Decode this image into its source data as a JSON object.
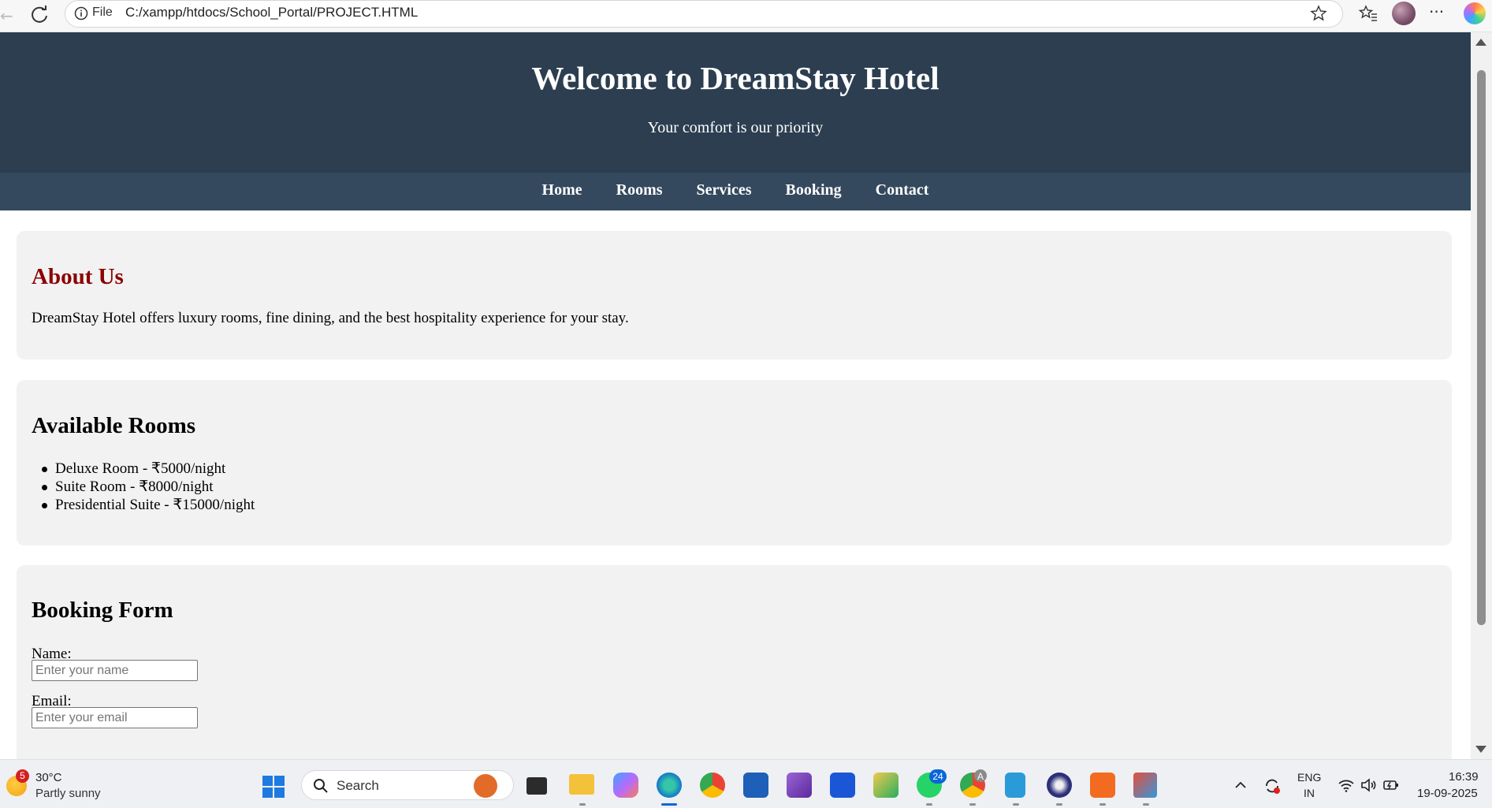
{
  "browser": {
    "file_label": "File",
    "url": "C:/xampp/htdocs/School_Portal/PROJECT.HTML"
  },
  "header": {
    "title": "Welcome to DreamStay Hotel",
    "tagline": "Your comfort is our priority"
  },
  "nav": {
    "items": [
      {
        "label": "Home"
      },
      {
        "label": "Rooms"
      },
      {
        "label": "Services"
      },
      {
        "label": "Booking"
      },
      {
        "label": "Contact"
      }
    ]
  },
  "about": {
    "heading": "About Us",
    "text": "DreamStay Hotel offers luxury rooms, fine dining, and the best hospitality experience for your stay."
  },
  "rooms": {
    "heading": "Available Rooms",
    "items": [
      "Deluxe Room - ₹5000/night",
      "Suite Room - ₹8000/night",
      "Presidential Suite - ₹15000/night"
    ]
  },
  "booking": {
    "heading": "Booking Form",
    "name_label": "Name:",
    "name_placeholder": "Enter your name",
    "email_label": "Email:",
    "email_placeholder": "Enter your email"
  },
  "taskbar": {
    "weather_badge": "5",
    "weather_temp": "30°C",
    "weather_desc": "Partly sunny",
    "search_label": "Search",
    "whatsapp_badge": "24",
    "chrome_badge": "A",
    "lang_primary": "ENG",
    "lang_region": "IN",
    "time": "16:39",
    "date": "19-09-2025"
  },
  "colors": {
    "header_bg": "#2c3e50",
    "nav_bg": "#34495e",
    "about_heading": "#8b0000",
    "card_bg": "#f2f2f2"
  }
}
